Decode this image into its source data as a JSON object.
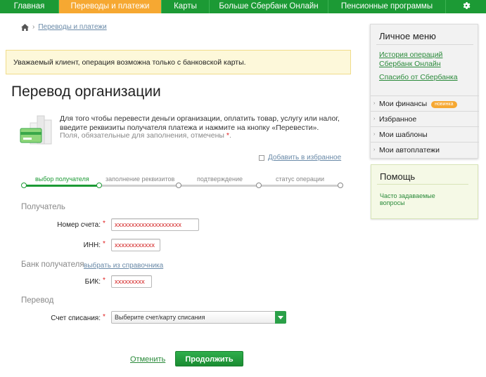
{
  "nav": {
    "items": [
      "Главная",
      "Переводы и платежи",
      "Карты",
      "Больше Сбербанк Онлайн",
      "Пенсионные программы"
    ],
    "active_index": 1,
    "settings_icon": "gear-icon"
  },
  "breadcrumb": {
    "home_icon": "home-icon",
    "current": "Переводы и платежи"
  },
  "warning": "Уважаемый клиент, операция возможна только с банковской карты.",
  "page_title": "Перевод организации",
  "intro": {
    "text": "Для того чтобы перевести деньги организации, оплатить товар, услугу или налог, введите реквизиты получателя платежа и нажмите на кнопку «Перевести».",
    "required_note": "Поля, обязательные для заполнения, отмечены",
    "required_mark": "*",
    "note_end": "."
  },
  "favorites_link": "Добавить в избранное",
  "steps": [
    "выбор получателя",
    "заполнение реквизитов",
    "подтверждение",
    "статус операции"
  ],
  "steps_completed": 1,
  "form": {
    "recipient_section": "Получатель",
    "account_label": "Номер счета:",
    "account_value": "xxxxxxxxxxxxxxxxxxxx",
    "inn_label": "ИНН:",
    "inn_value": "xxxxxxxxxxxx",
    "bank_section": "Банк получателя",
    "bank_lookup": "выбрать из справочника",
    "bik_label": "БИК:",
    "bik_value": "xxxxxxxxx",
    "transfer_section": "Перевод",
    "debit_label": "Счет списания:",
    "debit_placeholder": "Выберите счет/карту списания",
    "required_mark": "*"
  },
  "actions": {
    "cancel": "Отменить",
    "continue": "Продолжить"
  },
  "sidebar": {
    "title": "Личное меню",
    "link1": "История операций Сбербанк Онлайн",
    "link2": "Спасибо от Сбербанка",
    "menu": [
      {
        "label": "Мои финансы",
        "badge": "новинка"
      },
      {
        "label": "Избранное"
      },
      {
        "label": "Мои шаблоны"
      },
      {
        "label": "Мои автоплатежи"
      }
    ]
  },
  "help": {
    "title": "Помощь",
    "faq": "Часто задаваемые вопросы"
  },
  "colors": {
    "brand_green": "#1c9a35",
    "active_orange": "#f6a832",
    "required_red": "#e02020"
  }
}
